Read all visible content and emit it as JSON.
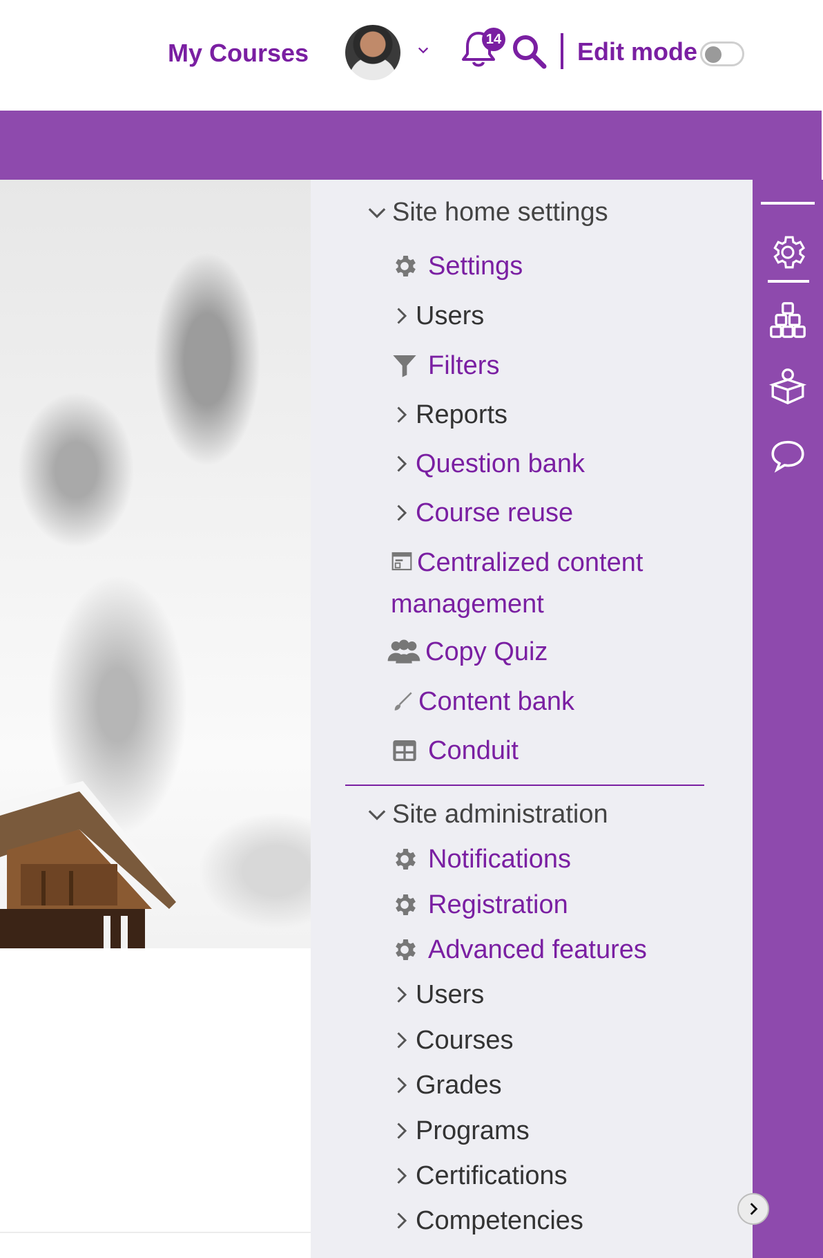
{
  "header": {
    "my_courses": "My Courses",
    "notifications_count": "14",
    "edit_mode_label": "Edit mode",
    "edit_mode_on": false
  },
  "colors": {
    "accent": "#7a1fa2",
    "banner": "#8e4aad",
    "drawer_bg": "#eeeef3",
    "text": "#333333"
  },
  "drawer": {
    "site_home": {
      "heading": "Site home settings",
      "items": [
        {
          "label": "Settings",
          "icon": "gear-icon"
        },
        {
          "label": "Users",
          "icon": "chevron-right-icon"
        },
        {
          "label": "Filters",
          "icon": "filter-icon"
        },
        {
          "label": "Reports",
          "icon": "chevron-right-icon"
        },
        {
          "label": "Question bank",
          "icon": "chevron-right-icon"
        },
        {
          "label": "Course reuse",
          "icon": "chevron-right-icon"
        },
        {
          "label": "Centralized content management",
          "icon": "content-management-icon"
        },
        {
          "label": "Copy Quiz",
          "icon": "users-group-icon"
        },
        {
          "label": "Content bank",
          "icon": "brush-icon"
        },
        {
          "label": "Conduit",
          "icon": "table-icon"
        }
      ]
    },
    "site_admin": {
      "heading": "Site administration",
      "items": [
        {
          "label": "Notifications",
          "icon": "gear-icon"
        },
        {
          "label": "Registration",
          "icon": "gear-icon"
        },
        {
          "label": "Advanced features",
          "icon": "gear-icon"
        },
        {
          "label": "Users",
          "icon": "chevron-right-icon"
        },
        {
          "label": "Courses",
          "icon": "chevron-right-icon"
        },
        {
          "label": "Grades",
          "icon": "chevron-right-icon"
        },
        {
          "label": "Programs",
          "icon": "chevron-right-icon"
        },
        {
          "label": "Certifications",
          "icon": "chevron-right-icon"
        },
        {
          "label": "Competencies",
          "icon": "chevron-right-icon"
        }
      ]
    }
  },
  "right_rail": {
    "icons": [
      "gear-icon",
      "blocks-icon",
      "course-box-icon",
      "chat-bubble-icon"
    ],
    "active": "gear-icon"
  }
}
